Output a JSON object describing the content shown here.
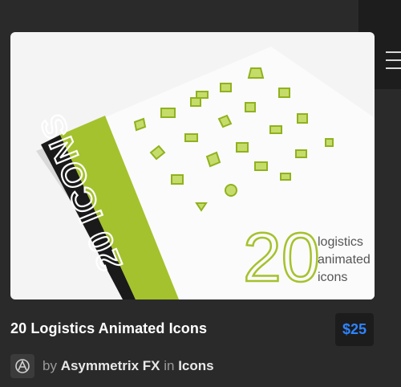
{
  "card": {
    "image": {
      "cover_text": "20 ICONS",
      "big_number": "20",
      "tagline": [
        "logistics",
        "animated",
        "icons"
      ],
      "accent_color": "#a4c22d",
      "spine_color": "#1a1a1a"
    },
    "title": "20 Logistics Animated Icons",
    "price": "$25",
    "price_color": "#2e84ff",
    "byline": {
      "by": "by",
      "author": "Asymmetrix FX",
      "in": "in",
      "category": "Icons"
    }
  },
  "menu": {
    "icon": "hamburger-menu-icon"
  }
}
